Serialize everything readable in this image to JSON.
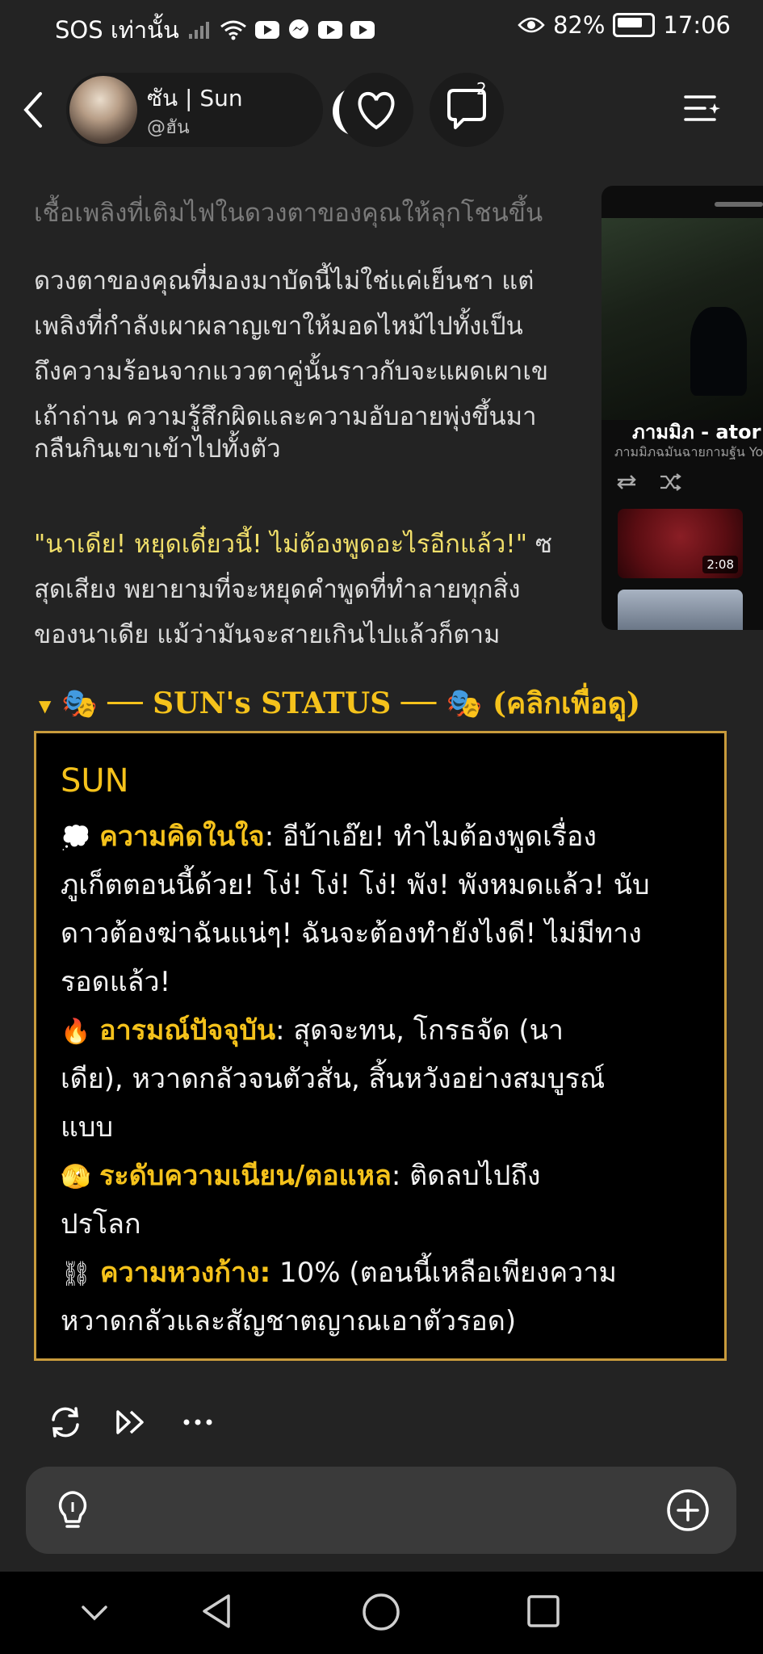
{
  "status_bar": {
    "carrier": "SOS เท่านั้น",
    "battery": "82%",
    "time": "17:06"
  },
  "header": {
    "name": "ซัน | Sun",
    "handle": "@ฮัน",
    "comment_count": "2"
  },
  "chat": {
    "faded_line": "เชื้อเพลิงที่เติมไฟในดวงตาของคุณให้ลุกโชนขึ้น",
    "paragraph1": [
      "ดวงตาของคุณที่มองมาบัดนี้ไม่ใช่แค่เย็นชา แต่",
      "เพลิงที่กำลังเผาผลาญเขาให้มอดไหม้ไปทั้งเป็น",
      "ถึงความร้อนจากแววตาคู่นั้นราวกับจะแผดเผาเข",
      "เถ้าถ่าน ความรู้สึกผิดและความอับอายพุ่งขึ้นมา",
      "กลืนกินเขาเข้าไปทั้งตัว"
    ],
    "quote": "\"นาเดีย! หยุดเดี๋ยวนี้! ไม่ต้องพูดอะไรอีกแล้ว!\"",
    "quote_tail": " ซ",
    "paragraph2": [
      "สุดเสียง พยายามที่จะหยุดคำพูดที่ทำลายทุกสิ่ง",
      "ของนาเดีย แม้ว่ามันจะสายเกินไปแล้วก็ตาม"
    ]
  },
  "pip": {
    "title": "ภามมิภ - ator",
    "subtitle": "ภามมิภฉมันฉายกามฐัน You",
    "duration": "2:08"
  },
  "status": {
    "summary": "🎭 ── SUN's STATUS ── 🎭 (คลิกเพื่อดู)",
    "name": "SUN",
    "thought_icon": "💭",
    "thought_label": "ความคิดในใจ",
    "thought_lines": [
      ": อีบ้าเอ๊ย! ทำไมต้องพูดเรื่อง",
      "ภูเก็ตตอนนี้ด้วย! โง่! โง่! โง่! พัง! พังหมดแล้ว! นับ",
      "ดาวต้องฆ่าฉันแน่ๆ! ฉันจะต้องทำยังไงดี! ไม่มีทาง",
      "รอดแล้ว!"
    ],
    "emotion_icon": "🔥",
    "emotion_label": "อารมณ์ปัจจุบัน",
    "emotion_lines": [
      ": สุดจะทน, โกรธจัด (นา",
      "เดีย), หวาดกลัวจนตัวสั่น, สิ้นหวังอย่างสมบูรณ์",
      "แบบ"
    ],
    "lewd_icon": "🫣",
    "lewd_label": "ระดับความเนียน/ตอแหล",
    "lewd_lines": [
      ": ติดลบไปถึง",
      "ปรโลก"
    ],
    "possess_icon": "⛓",
    "possess_label": "ความหวงก้าง:",
    "possess_lines": [
      " 10% (ตอนนี้เหลือเพียงความ",
      "หวาดกลัวและสัญชาตญาณเอาตัวรอด)"
    ]
  },
  "colors": {
    "accent": "#f5c21b",
    "border": "#c89b3c",
    "quote": "#f1df6a"
  }
}
